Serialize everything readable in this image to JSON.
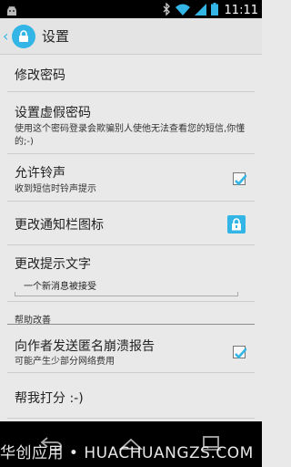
{
  "status_bar": {
    "time": "11:11",
    "icons": [
      "android-icon",
      "bluetooth-icon",
      "wifi-icon",
      "signal-icon",
      "battery-icon"
    ]
  },
  "action_bar": {
    "title": "设置",
    "app_icon": "lock-icon",
    "accent": "#33b5e5"
  },
  "settings": {
    "change_password": {
      "title": "修改密码"
    },
    "fake_password": {
      "title": "设置虚假密码",
      "summary": "使用这个密码登录会欺骗别人使他无法查看您的短信,你懂的;-)"
    },
    "allow_ringtone": {
      "title": "允许铃声",
      "summary": "收到短信时铃声提示",
      "checked": true
    },
    "notification_icon": {
      "title": "更改通知栏图标",
      "icon": "lock-icon"
    },
    "prompt_text": {
      "title": "更改提示文字",
      "value": "一个新消息被接受"
    },
    "help_section": {
      "header": "帮助改善"
    },
    "crash_report": {
      "title": "向作者发送匿名崩溃报告",
      "summary": "可能产生少部分网络费用",
      "checked": true
    },
    "rate_me": {
      "title": "帮我打分 :-)"
    }
  },
  "nav_bar": {
    "buttons": [
      "back-icon",
      "home-icon",
      "recents-icon"
    ]
  },
  "watermark": {
    "text": "华创应用 • HUACHUANGZS.COM"
  }
}
